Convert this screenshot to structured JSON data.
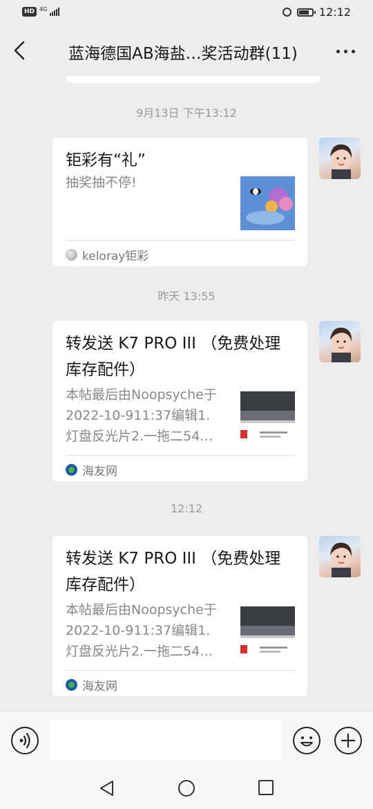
{
  "status_bar": {
    "hd_badge": "HD",
    "network": "4G",
    "time": "12:12"
  },
  "header": {
    "title": "蓝海德国AB海盐…奖活动群(11)"
  },
  "messages": {
    "ts1": "9月13日 下午13:12",
    "card1": {
      "title": "钜彩有“礼”",
      "desc": "抽奖抽不停!",
      "source": "keloray钜彩"
    },
    "ts2": "昨天 13:55",
    "card2": {
      "title_line1": "转发送 K7 PRO III （免费处理",
      "title_line2": "库存配件）",
      "desc_line1": "本帖最后由Noopsyche于",
      "desc_line2": "2022-10-911:37编辑1.",
      "desc_line3": "灯盘反光片2.一拖二54…",
      "source": "海友网"
    },
    "ts3": "12:12",
    "card3": {
      "title_line1": "转发送 K7 PRO III （免费处理",
      "title_line2": "库存配件）",
      "desc_line1": "本帖最后由Noopsyche于",
      "desc_line2": "2022-10-911:37编辑1.",
      "desc_line3": "灯盘反光片2.一拖二54…",
      "source": "海友网"
    }
  },
  "input": {
    "value": "",
    "placeholder": ""
  },
  "colors": {
    "background": "#ededed",
    "card": "#ffffff",
    "timestamp": "#999999"
  },
  "icons": [
    "back-arrow-icon",
    "more-icon",
    "voice-icon",
    "emoji-icon",
    "plus-icon",
    "nav-back-icon",
    "nav-home-icon",
    "nav-recent-icon"
  ]
}
